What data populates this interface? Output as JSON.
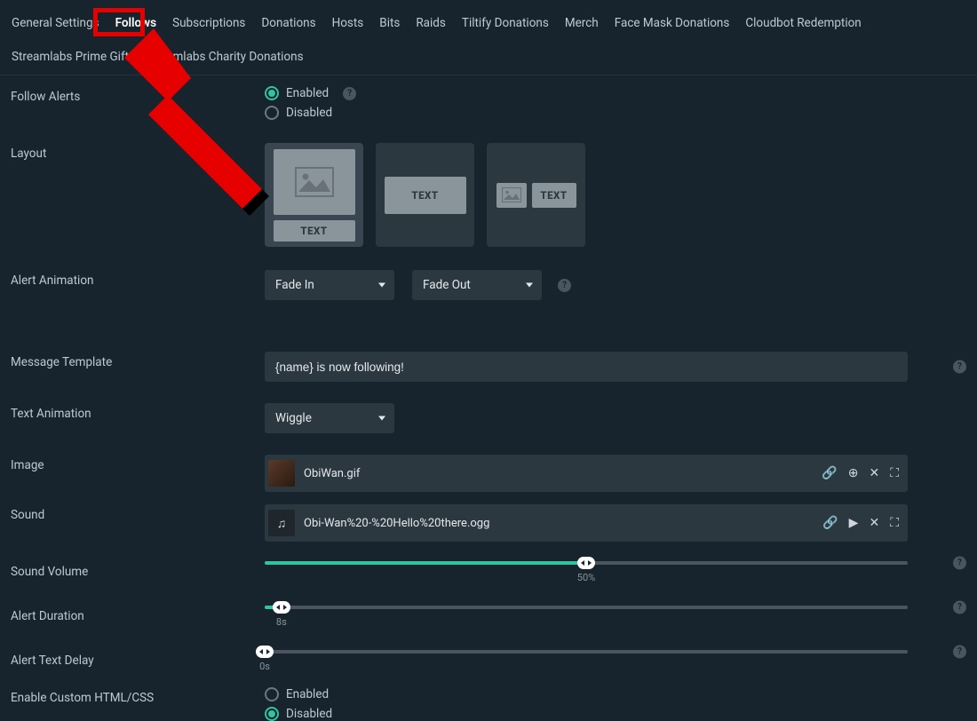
{
  "tabs": [
    {
      "label": "General Settings"
    },
    {
      "label": "Follows",
      "active": true
    },
    {
      "label": "Subscriptions"
    },
    {
      "label": "Donations"
    },
    {
      "label": "Hosts"
    },
    {
      "label": "Bits"
    },
    {
      "label": "Raids"
    },
    {
      "label": "Tiltify Donations"
    },
    {
      "label": "Merch"
    },
    {
      "label": "Face Mask Donations"
    },
    {
      "label": "Cloudbot Redemption"
    },
    {
      "label": "Streamlabs Prime Gift"
    },
    {
      "label": "Streamlabs Charity Donations"
    }
  ],
  "labels": {
    "follow_alerts": "Follow Alerts",
    "layout": "Layout",
    "alert_animation": "Alert Animation",
    "message_template": "Message Template",
    "text_animation": "Text Animation",
    "image": "Image",
    "sound": "Sound",
    "sound_volume": "Sound Volume",
    "alert_duration": "Alert Duration",
    "alert_text_delay": "Alert Text Delay",
    "enable_custom": "Enable Custom HTML/CSS"
  },
  "radios": {
    "enabled": "Enabled",
    "disabled": "Disabled"
  },
  "follow_alerts_value": "enabled",
  "custom_html_value": "disabled",
  "layout_choice_text": "TEXT",
  "layout_selected_index": 0,
  "anim_in": "Fade In",
  "anim_out": "Fade Out",
  "message_template_value": "{name} is now following!",
  "text_animation_value": "Wiggle",
  "image_file": "ObiWan.gif",
  "sound_file": "Obi-Wan%20-%20Hello%20there.ogg",
  "sound_volume": {
    "percent": 50,
    "display": "50%"
  },
  "alert_duration": {
    "seconds": 8,
    "display": "8s",
    "max": 300
  },
  "alert_text_delay": {
    "seconds": 0,
    "display": "0s",
    "max": 60
  },
  "help_glyph": "?",
  "icons": {
    "link": "🔗",
    "zoom": "⊕",
    "close": "✕",
    "grid": "⛶",
    "play": "▶",
    "note": "♫"
  }
}
